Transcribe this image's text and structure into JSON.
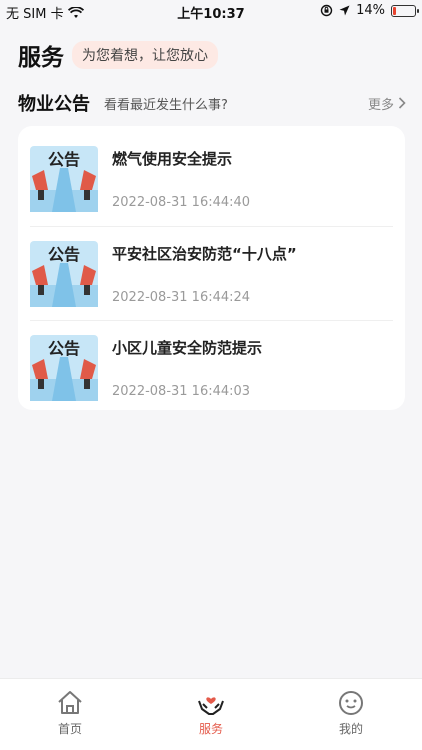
{
  "status_bar": {
    "carrier": "无 SIM 卡",
    "time": "上午10:37",
    "battery": "14%",
    "battery_level": 0.14
  },
  "header": {
    "title": "服务",
    "tagline": "为您着想，让您放心"
  },
  "notices": {
    "title": "物业公告",
    "subtitle": "看看最近发生什么事?",
    "more_label": "更多",
    "thumb_text": "公告",
    "items": [
      {
        "title": "燃气使用安全提示",
        "time": "2022-08-31 16:44:40"
      },
      {
        "title": "平安社区治安防范“十八点”",
        "time": "2022-08-31 16:44:24"
      },
      {
        "title": "小区儿童安全防范提示",
        "time": "2022-08-31 16:44:03"
      }
    ]
  },
  "tabbar": {
    "tabs": [
      {
        "label": "首页",
        "icon": "home-icon"
      },
      {
        "label": "服务",
        "icon": "service-hands-icon",
        "active": true
      },
      {
        "label": "我的",
        "icon": "profile-face-icon"
      }
    ]
  },
  "colors": {
    "accent": "#e45a4a",
    "tagline_bg": "#fde9e4",
    "background": "#f6f6f8"
  }
}
